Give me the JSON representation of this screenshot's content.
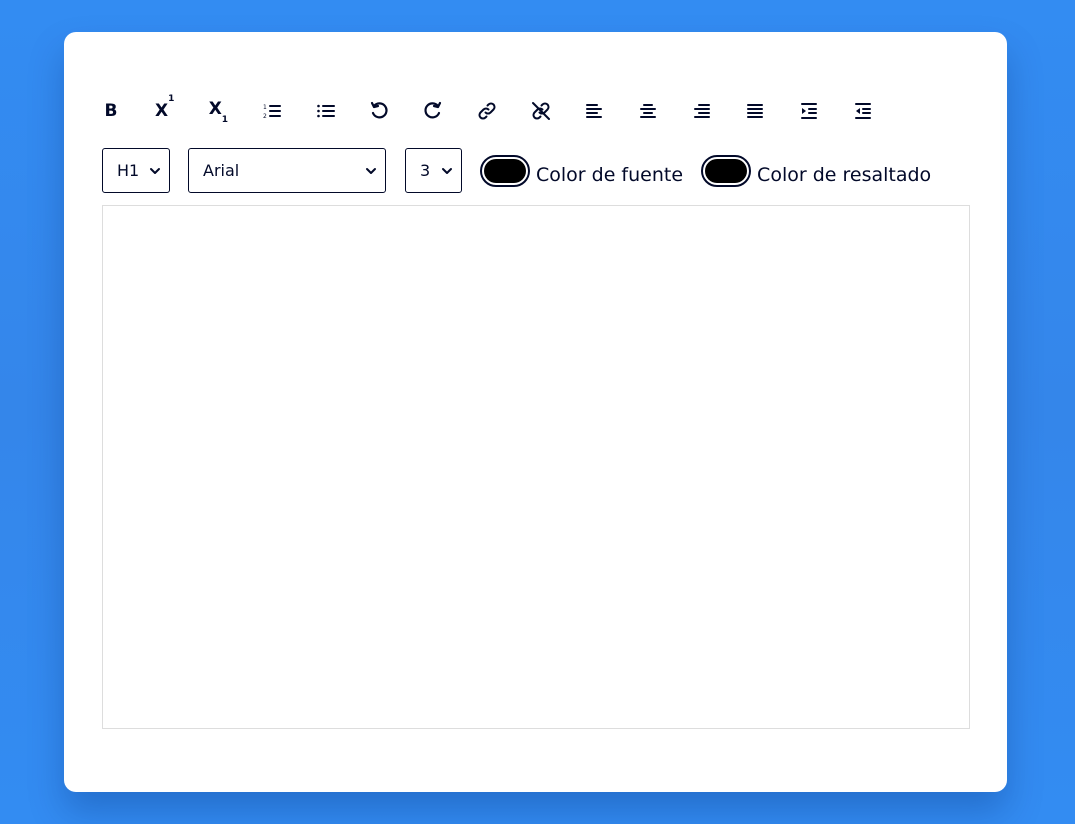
{
  "toolbar": {
    "buttons": [
      {
        "name": "bold-button",
        "icon": "bold-icon",
        "label": "B"
      },
      {
        "name": "superscript-button",
        "icon": "superscript-icon",
        "label": "X",
        "mark": "1"
      },
      {
        "name": "subscript-button",
        "icon": "subscript-icon",
        "label": "X",
        "mark": "1"
      },
      {
        "name": "ordered-list-button",
        "icon": "ordered-list-icon"
      },
      {
        "name": "unordered-list-button",
        "icon": "unordered-list-icon"
      },
      {
        "name": "undo-button",
        "icon": "undo-icon"
      },
      {
        "name": "redo-button",
        "icon": "redo-icon"
      },
      {
        "name": "link-button",
        "icon": "link-icon"
      },
      {
        "name": "unlink-button",
        "icon": "unlink-icon"
      },
      {
        "name": "align-left-button",
        "icon": "align-left-icon"
      },
      {
        "name": "align-center-button",
        "icon": "align-center-icon"
      },
      {
        "name": "align-right-button",
        "icon": "align-right-icon"
      },
      {
        "name": "align-justify-button",
        "icon": "align-justify-icon"
      },
      {
        "name": "indent-button",
        "icon": "indent-icon"
      },
      {
        "name": "outdent-button",
        "icon": "outdent-icon"
      }
    ]
  },
  "format": {
    "heading_value": "H1",
    "font_value": "Arial",
    "size_value": "3",
    "font_color": {
      "label": "Color de fuente",
      "value": "#000000"
    },
    "highlight_color": {
      "label": "Color de resaltado",
      "value": "#000000"
    }
  },
  "editor": {
    "content": ""
  },
  "colors": {
    "background": "#338cf2",
    "card": "#ffffff",
    "ink": "#020929"
  }
}
